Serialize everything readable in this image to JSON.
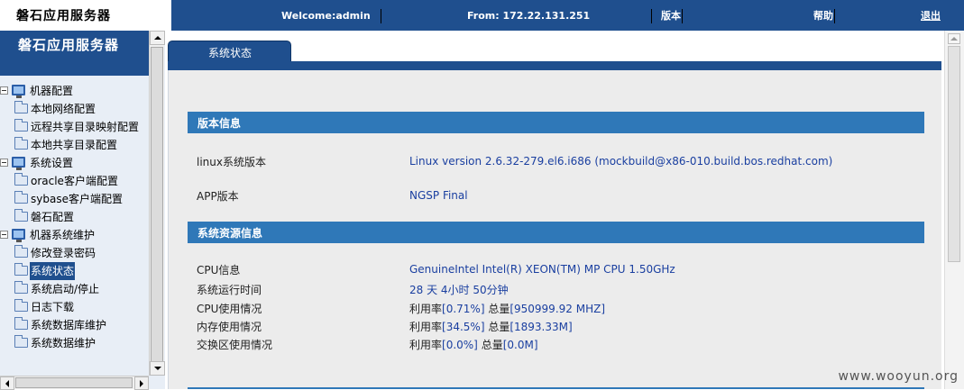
{
  "header": {
    "app_title": "磐石应用服务器",
    "welcome": "Welcome:admin",
    "from": "From: 172.22.131.251",
    "version_link": "版本",
    "help_link": "帮助",
    "logout_link": "退出"
  },
  "sidebar": {
    "title": "磐石应用服务器",
    "items": [
      {
        "label": "机器配置",
        "type": "group"
      },
      {
        "label": "本地网络配置",
        "type": "leaf"
      },
      {
        "label": "远程共享目录映射配置",
        "type": "leaf"
      },
      {
        "label": "本地共享目录配置",
        "type": "leaf"
      },
      {
        "label": "系统设置",
        "type": "group"
      },
      {
        "label": "oracle客户端配置",
        "type": "leaf"
      },
      {
        "label": "sybase客户端配置",
        "type": "leaf"
      },
      {
        "label": "磐石配置",
        "type": "leaf"
      },
      {
        "label": "机器系统维护",
        "type": "group"
      },
      {
        "label": "修改登录密码",
        "type": "leaf"
      },
      {
        "label": "系统状态",
        "type": "leaf",
        "selected": true
      },
      {
        "label": "系统启动/停止",
        "type": "leaf"
      },
      {
        "label": "日志下载",
        "type": "leaf"
      },
      {
        "label": "系统数据库维护",
        "type": "leaf"
      },
      {
        "label": "系统数据维护",
        "type": "leaf"
      }
    ]
  },
  "main": {
    "tab": "系统状态",
    "version_section": {
      "title": "版本信息",
      "linux_label": "linux系统版本",
      "linux_value": "Linux version 2.6.32-279.el6.i686 (mockbuild@x86-010.build.bos.redhat.com)",
      "app_label": "APP版本",
      "app_value": "NGSP Final"
    },
    "resource_section": {
      "title": "系统资源信息",
      "cpu_info_label": "CPU信息",
      "cpu_info_value": "GenuineIntel Intel(R) XEON(TM) MP CPU 1.50GHz",
      "uptime_label": "系统运行时间",
      "uptime_value": "28 天  4小时  50分钟",
      "cpu_usage_label": "CPU使用情况",
      "cpu_usage": {
        "rate_label": "利用率",
        "rate": "[0.71%]",
        "total_label": " 总量",
        "total": "[950999.92 MHZ]"
      },
      "mem_usage_label": "内存使用情况",
      "mem_usage": {
        "rate_label": "利用率",
        "rate": "[34.5%]",
        "total_label": " 总量",
        "total": "[1893.33M]"
      },
      "swap_usage_label": "交换区使用情况",
      "swap_usage": {
        "rate_label": "利用率",
        "rate": "[0.0%]",
        "total_label": " 总量",
        "total": "[0.0M]"
      }
    }
  },
  "watermark": "www.wooyun.org",
  "colors": {
    "header_blue": "#1f4f8e",
    "section_blue": "#2f78b8",
    "value_blue": "#1a3fa0",
    "content_bg": "#ececec"
  }
}
